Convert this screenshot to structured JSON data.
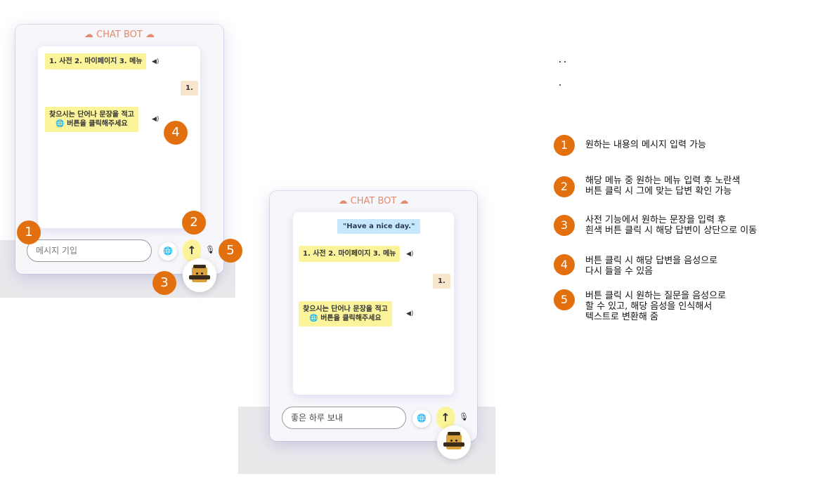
{
  "widget": {
    "title": "☁ CHAT BOT ☁",
    "menu_message": "1. 사전 2. 마이페이지 3. 메뉴",
    "user_message": "1.",
    "prompt_line1": "찾으시는 단어나 문장을 적고",
    "prompt_line2": "🌐 버튼을 클릭해주세요",
    "input_placeholder": "메시지 기입",
    "send_icon": "↑",
    "globe_icon": "🌐",
    "mic_icon": "🎙",
    "speaker_icon": "◀)",
    "avatar": "robot-avatar"
  },
  "widget2": {
    "title": "☁ CHAT BOT ☁",
    "translation": "\"Have a nice day.\"",
    "menu_message": "1. 사전 2. 마이페이지 3. 메뉴",
    "user_message": "1.",
    "prompt_line1": "찾으시는 단어나 문장을 적고",
    "prompt_line2": "🌐 버튼을 클릭해주세요",
    "input_value": "좋은 하루 보내"
  },
  "badges": [
    "1",
    "2",
    "3",
    "4",
    "5"
  ],
  "legend": [
    {
      "num": "1",
      "lines": [
        "원하는 내용의 메시지 입력 가능"
      ]
    },
    {
      "num": "2",
      "lines": [
        "해당 메뉴 중 원하는 메뉴 입력 후 노란색",
        "버튼 클릭 시 그에 맞는 답변 확인 가능"
      ]
    },
    {
      "num": "3",
      "lines": [
        "사전 기능에서 원하는 문장을 입력 후",
        "흰색 버튼 클릭 시 해당 답변이 상단으로 이동"
      ]
    },
    {
      "num": "4",
      "lines": [
        "버튼 클릭 시 해당 답변을 음성으로",
        "다시 들을 수 있음"
      ]
    },
    {
      "num": "5",
      "lines": [
        "버튼 클릭 시 원하는 질문을 음성으로",
        "할 수 있고, 해당 음성을 인식해서",
        "텍스트로 변환해 줌"
      ]
    }
  ],
  "colors": {
    "badge": "#e2700f",
    "yellow": "#fbf49a",
    "user": "#f8e6cc",
    "blue": "#c6e8fb",
    "title": "#e08a6e"
  }
}
